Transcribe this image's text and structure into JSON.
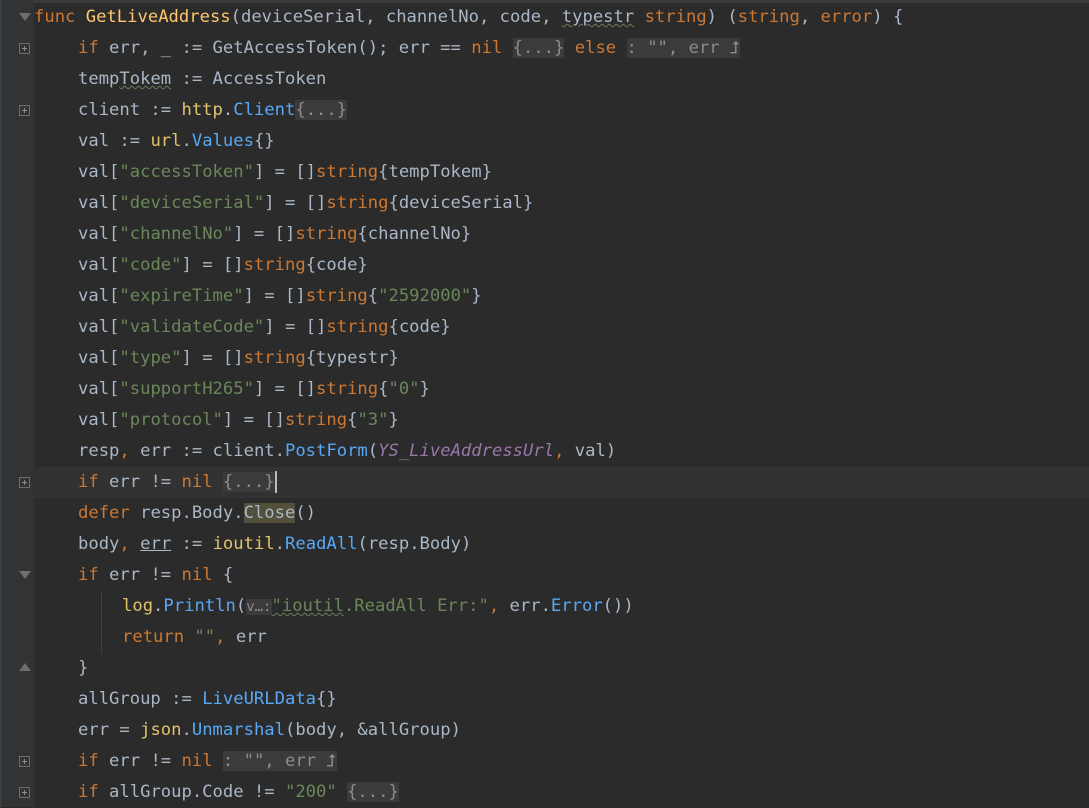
{
  "editor": {
    "theme": {
      "background": "#2b2b2b",
      "keyword": "#cc7832",
      "function": "#ffc66d",
      "string": "#6a8759",
      "plain": "#a9b7c6",
      "call": "#57a8f5",
      "constant": "#9876aa"
    },
    "lines": [
      {
        "indent": 0,
        "fold": "open",
        "tokens": [
          [
            "kw",
            "func"
          ],
          [
            "p",
            " "
          ],
          [
            "fn",
            "GetLiveAddress"
          ],
          [
            "p",
            "(deviceSerial, channelNo, code, "
          ],
          [
            "pu",
            "typestr"
          ],
          [
            "p",
            " "
          ],
          [
            "kw",
            "string"
          ],
          [
            "p",
            ") ("
          ],
          [
            "kw",
            "string"
          ],
          [
            "p",
            ", "
          ],
          [
            "kw",
            "error"
          ],
          [
            "p",
            ") {"
          ]
        ]
      },
      {
        "indent": 1,
        "fold": "plus",
        "tokens": [
          [
            "kw",
            "if"
          ],
          [
            "p",
            " err, _ := GetAccessToken(); err == "
          ],
          [
            "kw",
            "nil"
          ],
          [
            "p",
            " "
          ],
          [
            "fold",
            "{...}"
          ],
          [
            "p",
            " "
          ],
          [
            "kw",
            "else"
          ],
          [
            "p",
            " "
          ],
          [
            "fold",
            ": \"\", err ⮥"
          ]
        ]
      },
      {
        "indent": 1,
        "tokens": [
          [
            "p",
            "temp"
          ],
          [
            "pu",
            "Tokem"
          ],
          [
            "p",
            " := AccessToken"
          ]
        ]
      },
      {
        "indent": 1,
        "fold": "plus",
        "tokens": [
          [
            "p",
            "client := "
          ],
          [
            "pkg",
            "http"
          ],
          [
            "p",
            "."
          ],
          [
            "call",
            "Client"
          ],
          [
            "fold",
            "{...}"
          ]
        ]
      },
      {
        "indent": 1,
        "tokens": [
          [
            "p",
            "val := "
          ],
          [
            "pkg",
            "url"
          ],
          [
            "p",
            "."
          ],
          [
            "call",
            "Values"
          ],
          [
            "p",
            "{}"
          ]
        ]
      },
      {
        "indent": 1,
        "tokens": [
          [
            "p",
            "val["
          ],
          [
            "str",
            "\"accessToken\""
          ],
          [
            "p",
            "] = []"
          ],
          [
            "kw",
            "string"
          ],
          [
            "p",
            "{tempTokem}"
          ]
        ]
      },
      {
        "indent": 1,
        "tokens": [
          [
            "p",
            "val["
          ],
          [
            "str",
            "\"deviceSerial\""
          ],
          [
            "p",
            "] = []"
          ],
          [
            "kw",
            "string"
          ],
          [
            "p",
            "{deviceSerial}"
          ]
        ]
      },
      {
        "indent": 1,
        "tokens": [
          [
            "p",
            "val["
          ],
          [
            "str",
            "\"channelNo\""
          ],
          [
            "p",
            "] = []"
          ],
          [
            "kw",
            "string"
          ],
          [
            "p",
            "{channelNo}"
          ]
        ]
      },
      {
        "indent": 1,
        "tokens": [
          [
            "p",
            "val["
          ],
          [
            "str",
            "\"code\""
          ],
          [
            "p",
            "] = []"
          ],
          [
            "kw",
            "string"
          ],
          [
            "p",
            "{code}"
          ]
        ]
      },
      {
        "indent": 1,
        "tokens": [
          [
            "p",
            "val["
          ],
          [
            "str",
            "\"expireTime\""
          ],
          [
            "p",
            "] = []"
          ],
          [
            "kw",
            "string"
          ],
          [
            "p",
            "{"
          ],
          [
            "str",
            "\"2592000\""
          ],
          [
            "p",
            "}"
          ]
        ]
      },
      {
        "indent": 1,
        "tokens": [
          [
            "p",
            "val["
          ],
          [
            "str",
            "\"validateCode\""
          ],
          [
            "p",
            "] = []"
          ],
          [
            "kw",
            "string"
          ],
          [
            "p",
            "{code}"
          ]
        ]
      },
      {
        "indent": 1,
        "tokens": [
          [
            "p",
            "val["
          ],
          [
            "str",
            "\"type\""
          ],
          [
            "p",
            "] = []"
          ],
          [
            "kw",
            "string"
          ],
          [
            "p",
            "{typestr}"
          ]
        ]
      },
      {
        "indent": 1,
        "tokens": [
          [
            "p",
            "val["
          ],
          [
            "str",
            "\"supportH265\""
          ],
          [
            "p",
            "] = []"
          ],
          [
            "kw",
            "string"
          ],
          [
            "p",
            "{"
          ],
          [
            "str",
            "\"0\""
          ],
          [
            "p",
            "}"
          ]
        ]
      },
      {
        "indent": 1,
        "tokens": [
          [
            "p",
            "val["
          ],
          [
            "str",
            "\"protocol\""
          ],
          [
            "p",
            "] = []"
          ],
          [
            "kw",
            "string"
          ],
          [
            "p",
            "{"
          ],
          [
            "str",
            "\"3\""
          ],
          [
            "p",
            "}"
          ]
        ]
      },
      {
        "indent": 1,
        "tokens": [
          [
            "p",
            "resp"
          ],
          [
            "kw",
            ","
          ],
          [
            "p",
            " err := client."
          ],
          [
            "call",
            "PostForm"
          ],
          [
            "p",
            "("
          ],
          [
            "const",
            "YS_LiveAddressUrl"
          ],
          [
            "kw",
            ","
          ],
          [
            "p",
            " val)"
          ]
        ]
      },
      {
        "indent": 1,
        "fold": "plus",
        "current": true,
        "tokens": [
          [
            "kw",
            "if"
          ],
          [
            "p",
            " err != "
          ],
          [
            "kw",
            "nil"
          ],
          [
            "p",
            " "
          ],
          [
            "fold",
            "{...}"
          ],
          [
            "caret",
            ""
          ]
        ]
      },
      {
        "indent": 1,
        "tokens": [
          [
            "kw",
            "defer"
          ],
          [
            "p",
            " resp.Body."
          ],
          [
            "hl",
            "Close"
          ],
          [
            "p",
            "()"
          ]
        ]
      },
      {
        "indent": 1,
        "tokens": [
          [
            "p",
            "body"
          ],
          [
            "kw",
            ","
          ],
          [
            "p",
            " "
          ],
          [
            "ul",
            "err"
          ],
          [
            "p",
            " := "
          ],
          [
            "pkg",
            "ioutil"
          ],
          [
            "p",
            "."
          ],
          [
            "call",
            "ReadAll"
          ],
          [
            "p",
            "(resp.Body)"
          ]
        ]
      },
      {
        "indent": 1,
        "fold": "open",
        "tokens": [
          [
            "kw",
            "if"
          ],
          [
            "p",
            " err != "
          ],
          [
            "kw",
            "nil"
          ],
          [
            "p",
            " {"
          ]
        ]
      },
      {
        "indent": 2,
        "tokens": [
          [
            "pkg",
            "log"
          ],
          [
            "p",
            "."
          ],
          [
            "call",
            "Println"
          ],
          [
            "p",
            "("
          ],
          [
            "hint",
            "v…:"
          ],
          [
            "stru",
            "\"ioutil"
          ],
          [
            "str",
            ".ReadAll Err:\""
          ],
          [
            "kw",
            ","
          ],
          [
            "p",
            " err."
          ],
          [
            "call",
            "Error"
          ],
          [
            "p",
            "())"
          ]
        ]
      },
      {
        "indent": 2,
        "tokens": [
          [
            "kw",
            "return"
          ],
          [
            "p",
            " "
          ],
          [
            "str",
            "\"\""
          ],
          [
            "kw",
            ","
          ],
          [
            "p",
            " err"
          ]
        ]
      },
      {
        "indent": 1,
        "fold": "close",
        "tokens": [
          [
            "p",
            "}"
          ]
        ]
      },
      {
        "indent": 1,
        "tokens": [
          [
            "p",
            "allGroup := "
          ],
          [
            "call",
            "LiveURLData"
          ],
          [
            "p",
            "{}"
          ]
        ]
      },
      {
        "indent": 1,
        "tokens": [
          [
            "p",
            "err = "
          ],
          [
            "pkg",
            "json"
          ],
          [
            "p",
            "."
          ],
          [
            "call",
            "Unmarshal"
          ],
          [
            "p",
            "(body, &allGroup)"
          ]
        ]
      },
      {
        "indent": 1,
        "fold": "plus",
        "tokens": [
          [
            "kw",
            "if"
          ],
          [
            "p",
            " err != "
          ],
          [
            "kw",
            "nil"
          ],
          [
            "p",
            " "
          ],
          [
            "fold",
            ": \"\", err ⮥"
          ]
        ]
      },
      {
        "indent": 1,
        "fold": "plus",
        "tokens": [
          [
            "kw",
            "if"
          ],
          [
            "p",
            " allGroup.Code != "
          ],
          [
            "str",
            "\"200\""
          ],
          [
            "p",
            " "
          ],
          [
            "fold",
            "{...}"
          ]
        ]
      }
    ]
  }
}
